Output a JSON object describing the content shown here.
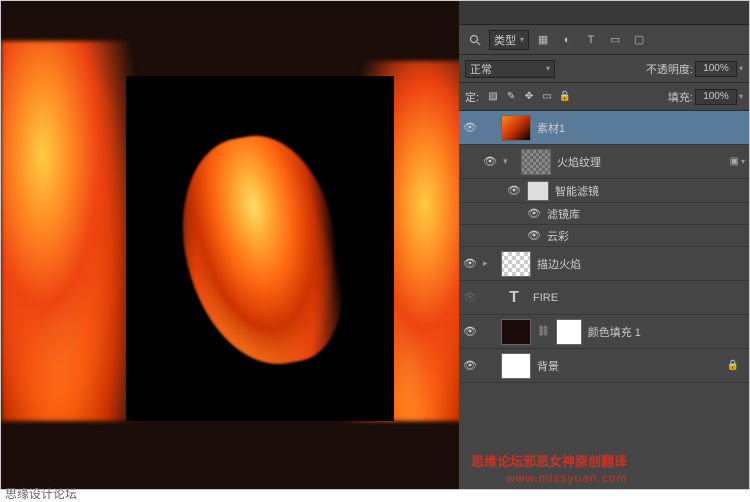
{
  "toolbar": {
    "kind_label": "类型",
    "search_icon": "search"
  },
  "blend": {
    "mode": "正常",
    "opacity_label": "不透明度:",
    "opacity_value": "100%"
  },
  "lock": {
    "label": "定:",
    "fill_label": "填充:",
    "fill_value": "100%"
  },
  "layers": [
    {
      "name": "素材1",
      "selected": true,
      "thumb": "fire",
      "eye": true,
      "toggle": ""
    },
    {
      "name": "火焰纹理",
      "thumb": "texture",
      "eye": true,
      "toggle": "▾",
      "fx": true,
      "sub": 1
    },
    {
      "name": "智能滤镜",
      "thumb": "smart",
      "eye": true,
      "sub": 2
    },
    {
      "name": "滤镜库",
      "eye": true,
      "sub": 3
    },
    {
      "name": "云彩",
      "eye": true,
      "sub": 3
    },
    {
      "name": "描边火焰",
      "thumb": "checker",
      "eye": true,
      "toggle": "▸",
      "sub": 0
    },
    {
      "name": "FIRE",
      "type_icon": "T",
      "eye": false,
      "sub": 0
    },
    {
      "name": "颜色填充 1",
      "thumb": "solid-dark",
      "mask": true,
      "eye": true,
      "sub": 0
    },
    {
      "name": "背景",
      "thumb": "white",
      "eye": true,
      "locked": true,
      "sub": 0
    }
  ],
  "watermark": {
    "cn": "思缘论坛邪恶女神原创翻译",
    "url": "www.missyuan.com"
  },
  "footer": "思缘设计论坛"
}
